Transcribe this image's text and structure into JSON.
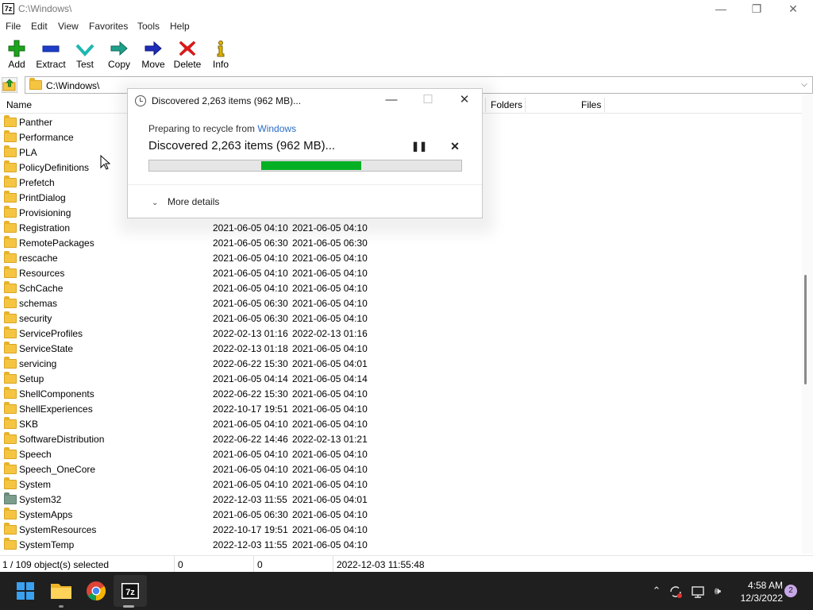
{
  "window": {
    "title": "C:\\Windows\\",
    "app_icon": "7z",
    "minimize": "—",
    "maximize": "❐",
    "close": "✕"
  },
  "menu": [
    "File",
    "Edit",
    "View",
    "Favorites",
    "Tools",
    "Help"
  ],
  "toolbar": [
    {
      "label": "Add",
      "icon": "plus-icon"
    },
    {
      "label": "Extract",
      "icon": "minus-icon"
    },
    {
      "label": "Test",
      "icon": "check-icon"
    },
    {
      "label": "Copy",
      "icon": "copy-arrow-icon"
    },
    {
      "label": "Move",
      "icon": "move-arrow-icon"
    },
    {
      "label": "Delete",
      "icon": "x-icon"
    },
    {
      "label": "Info",
      "icon": "info-icon"
    }
  ],
  "address": {
    "path": "C:\\Windows\\"
  },
  "columns": {
    "name": "Name",
    "folders": "Folders",
    "files": "Files"
  },
  "rows": [
    {
      "name": "Panther",
      "modified": "",
      "created": ""
    },
    {
      "name": "Performance",
      "modified": "",
      "created": ""
    },
    {
      "name": "PLA",
      "modified": "",
      "created": ""
    },
    {
      "name": "PolicyDefinitions",
      "modified": "",
      "created": ""
    },
    {
      "name": "Prefetch",
      "modified": "",
      "created": ""
    },
    {
      "name": "PrintDialog",
      "modified": "",
      "created": ""
    },
    {
      "name": "Provisioning",
      "modified": "",
      "created": ""
    },
    {
      "name": "Registration",
      "modified": "2021-06-05 04:10",
      "created": "2021-06-05 04:10"
    },
    {
      "name": "RemotePackages",
      "modified": "2021-06-05 06:30",
      "created": "2021-06-05 06:30"
    },
    {
      "name": "rescache",
      "modified": "2021-06-05 04:10",
      "created": "2021-06-05 04:10"
    },
    {
      "name": "Resources",
      "modified": "2021-06-05 04:10",
      "created": "2021-06-05 04:10"
    },
    {
      "name": "SchCache",
      "modified": "2021-06-05 04:10",
      "created": "2021-06-05 04:10"
    },
    {
      "name": "schemas",
      "modified": "2021-06-05 06:30",
      "created": "2021-06-05 04:10"
    },
    {
      "name": "security",
      "modified": "2021-06-05 06:30",
      "created": "2021-06-05 04:10"
    },
    {
      "name": "ServiceProfiles",
      "modified": "2022-02-13 01:16",
      "created": "2022-02-13 01:16"
    },
    {
      "name": "ServiceState",
      "modified": "2022-02-13 01:18",
      "created": "2021-06-05 04:10"
    },
    {
      "name": "servicing",
      "modified": "2022-06-22 15:30",
      "created": "2021-06-05 04:01"
    },
    {
      "name": "Setup",
      "modified": "2021-06-05 04:14",
      "created": "2021-06-05 04:14"
    },
    {
      "name": "ShellComponents",
      "modified": "2022-06-22 15:30",
      "created": "2021-06-05 04:10"
    },
    {
      "name": "ShellExperiences",
      "modified": "2022-10-17 19:51",
      "created": "2021-06-05 04:10"
    },
    {
      "name": "SKB",
      "modified": "2021-06-05 04:10",
      "created": "2021-06-05 04:10"
    },
    {
      "name": "SoftwareDistribution",
      "modified": "2022-06-22 14:46",
      "created": "2022-02-13 01:21"
    },
    {
      "name": "Speech",
      "modified": "2021-06-05 04:10",
      "created": "2021-06-05 04:10"
    },
    {
      "name": "Speech_OneCore",
      "modified": "2021-06-05 04:10",
      "created": "2021-06-05 04:10"
    },
    {
      "name": "System",
      "modified": "2021-06-05 04:10",
      "created": "2021-06-05 04:10"
    },
    {
      "name": "System32",
      "modified": "2022-12-03 11:55",
      "created": "2021-06-05 04:01",
      "system": true
    },
    {
      "name": "SystemApps",
      "modified": "2021-06-05 06:30",
      "created": "2021-06-05 04:10"
    },
    {
      "name": "SystemResources",
      "modified": "2022-10-17 19:51",
      "created": "2021-06-05 04:10"
    },
    {
      "name": "SystemTemp",
      "modified": "2022-12-03 11:55",
      "created": "2021-06-05 04:10"
    }
  ],
  "status": {
    "selection": "1 / 109 object(s) selected",
    "size": "0",
    "packed": "0",
    "date": "2022-12-03 11:55:48"
  },
  "dialog": {
    "title": "Discovered 2,263 items (962 MB)...",
    "preparing": "Preparing to recycle from ",
    "source": "Windows",
    "heading": "Discovered 2,263 items (962 MB)...",
    "pause": "❚❚",
    "cancel": "✕",
    "minimize": "—",
    "maximize": "☐",
    "close": "✕",
    "progress_start": 0.36,
    "progress_end": 0.68,
    "progress_color": "#06b025",
    "more_details": "More details",
    "more_chevron": "⌄"
  },
  "taskbar": {
    "apps": [
      {
        "name": "start-button",
        "icon": "windows-logo-icon"
      },
      {
        "name": "file-explorer",
        "icon": "folder-icon"
      },
      {
        "name": "chrome",
        "icon": "chrome-icon"
      },
      {
        "name": "7zip",
        "icon": "7z",
        "label": "7z"
      }
    ],
    "tray": {
      "chevron": "⌃",
      "volume": "🕪"
    },
    "time": "4:58 AM",
    "date": "12/3/2022",
    "notifications": "2"
  }
}
